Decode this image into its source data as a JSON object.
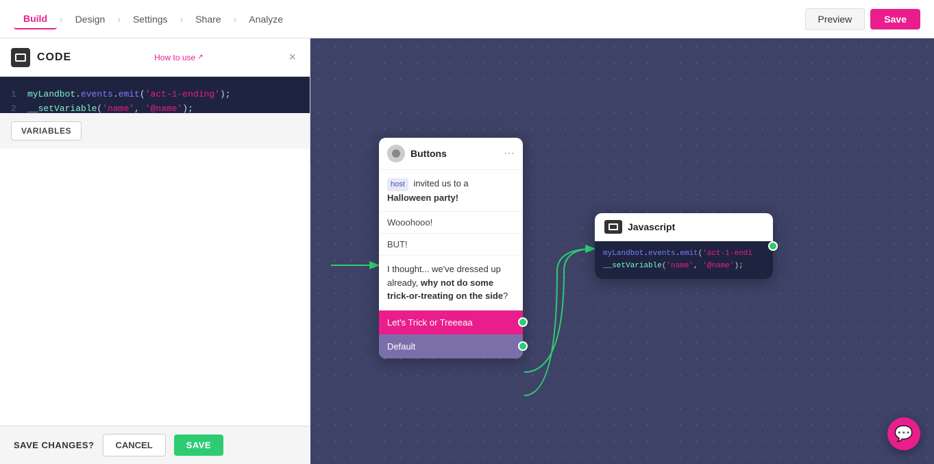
{
  "topNav": {
    "tabs": [
      {
        "label": "Build",
        "active": true
      },
      {
        "label": "Design",
        "active": false
      },
      {
        "label": "Settings",
        "active": false
      },
      {
        "label": "Share",
        "active": false
      },
      {
        "label": "Analyze",
        "active": false
      }
    ],
    "previewLabel": "Preview",
    "saveLabel": "Save"
  },
  "leftPanel": {
    "title": "CODE",
    "howToUse": "How to use",
    "closeLabel": "×",
    "code": {
      "line1": {
        "num": "1",
        "text": "myLandbot.events.emit('act-1-ending');"
      },
      "line2": {
        "num": "2",
        "text": "__setVariable('name', '@name');"
      }
    },
    "variablesLabel": "VARIABLES"
  },
  "bottomBar": {
    "saveChangesLabel": "SAVE CHANGES?",
    "cancelLabel": "CANCEL",
    "saveLabel": "SAVE"
  },
  "canvas": {
    "buttonsNode": {
      "title": "Buttons",
      "hostBadge": "host",
      "message1a": "invited us to a",
      "message1b": "Halloween party!",
      "message2": "Wooohooo!",
      "message3": "BUT!",
      "message4a": "I thought... we've dressed up already,",
      "message4b": "why not do some trick-or-treating on the side",
      "message4c": "?",
      "btn1": "Let's Trick or Treeeaa",
      "btn2": "Default"
    },
    "jsNode": {
      "title": "Javascript",
      "code": {
        "line1": "myLandbot.events.emit('act-1-endi",
        "line2": "__setVariable('name', '@name');"
      }
    }
  },
  "chatBubble": {
    "icon": "💬"
  }
}
